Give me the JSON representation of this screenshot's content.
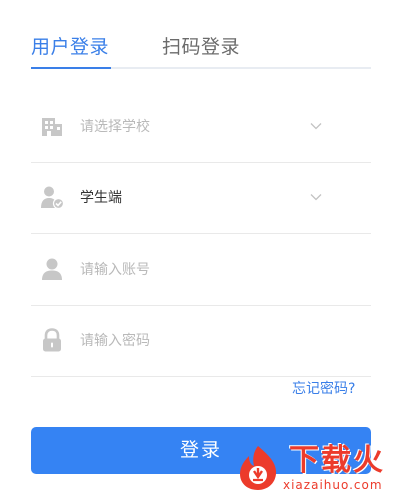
{
  "tabs": {
    "user_login": "用户登录",
    "scan_login": "扫码登录"
  },
  "form": {
    "school_placeholder": "请选择学校",
    "role_value": "学生端",
    "account_placeholder": "请输入账号",
    "password_placeholder": "请输入密码",
    "forgot_password": "忘记密码?"
  },
  "login_button": "登录",
  "watermark": {
    "brand": "下载火",
    "site": "xiazaihuo.com"
  },
  "colors": {
    "accent": "#3a7fe8",
    "button": "#3583f3",
    "watermark": "#ec3b2b"
  },
  "icons": [
    "building-icon",
    "student-user-icon",
    "user-icon",
    "lock-icon",
    "chevron-down-icon"
  ]
}
